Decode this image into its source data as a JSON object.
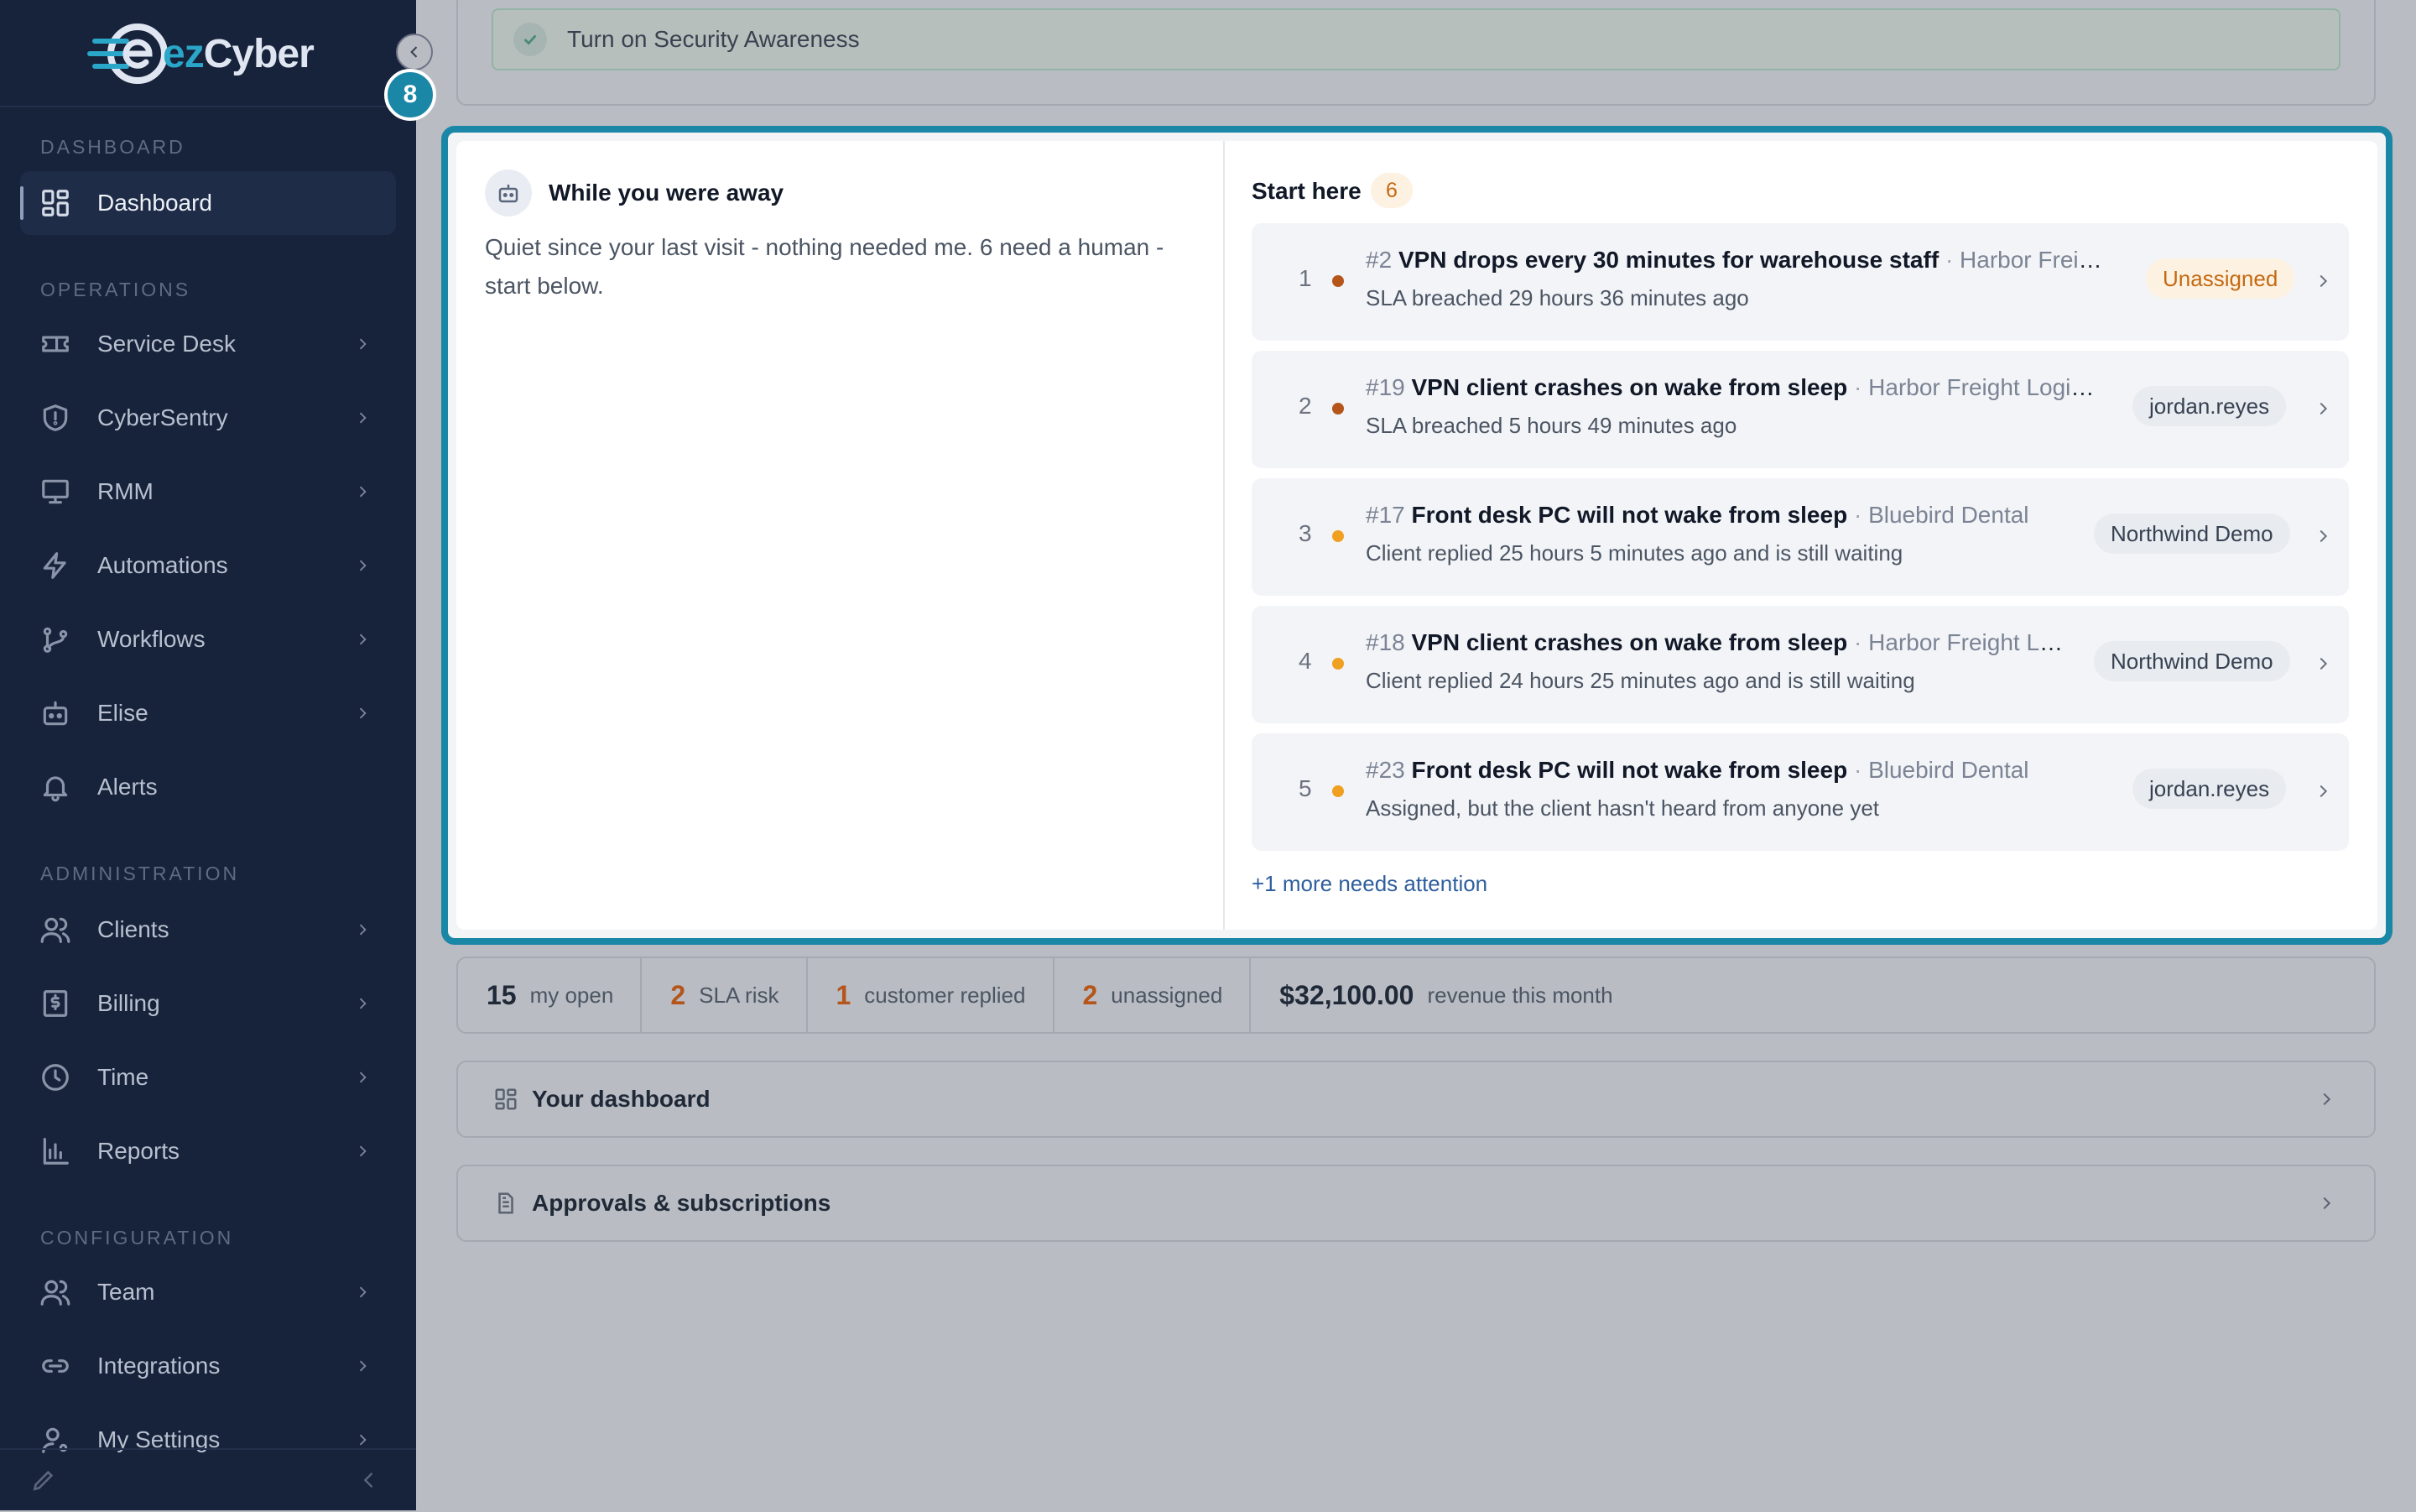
{
  "brand": {
    "name_prefix": "ez",
    "name_suffix": "Cyber"
  },
  "colors": {
    "accent": "#1b87a6",
    "sidebar_bg": "#17223b",
    "warning": "#c46a12",
    "breach_dot": "#b5551a",
    "waiting_dot": "#f0a020"
  },
  "step_badge": "8",
  "sidebar": {
    "sections": [
      {
        "label": "DASHBOARD",
        "items": [
          {
            "label": "Dashboard",
            "icon": "dashboard-grid-icon",
            "active": true
          }
        ]
      },
      {
        "label": "OPERATIONS",
        "items": [
          {
            "label": "Service Desk",
            "icon": "ticket-icon"
          },
          {
            "label": "CyberSentry",
            "icon": "shield-icon"
          },
          {
            "label": "RMM",
            "icon": "monitor-icon"
          },
          {
            "label": "Automations",
            "icon": "lightning-icon"
          },
          {
            "label": "Workflows",
            "icon": "git-branch-icon"
          },
          {
            "label": "Elise",
            "icon": "robot-icon"
          },
          {
            "label": "Alerts",
            "icon": "bell-icon"
          }
        ]
      },
      {
        "label": "ADMINISTRATION",
        "items": [
          {
            "label": "Clients",
            "icon": "users-icon"
          },
          {
            "label": "Billing",
            "icon": "dollar-receipt-icon"
          },
          {
            "label": "Time",
            "icon": "clock-icon"
          },
          {
            "label": "Reports",
            "icon": "bar-chart-icon"
          }
        ]
      },
      {
        "label": "CONFIGURATION",
        "items": [
          {
            "label": "Team",
            "icon": "team-icon"
          },
          {
            "label": "Integrations",
            "icon": "link-icon"
          },
          {
            "label": "My Settings",
            "icon": "user-settings-icon"
          }
        ]
      }
    ]
  },
  "banner": {
    "text": "Turn on Security Awareness"
  },
  "away": {
    "title": "While you were away",
    "text": "Quiet since your last visit - nothing needed me. 6 need a human - start below."
  },
  "start": {
    "title": "Start here",
    "count": "6",
    "tickets": [
      {
        "rank": "1",
        "id": "#2",
        "title": "VPN drops every 30 minutes for warehouse staff",
        "client": "Harbor Freight...",
        "status": "SLA breached 29 hours 36 minutes ago",
        "tag": "Unassigned",
        "tag_type": "unassigned",
        "dot": "breach"
      },
      {
        "rank": "2",
        "id": "#19",
        "title": "VPN client crashes on wake from sleep",
        "client": "Harbor Freight Logistics",
        "status": "SLA breached 5 hours 49 minutes ago",
        "tag": "jordan.reyes",
        "tag_type": "user",
        "dot": "breach"
      },
      {
        "rank": "3",
        "id": "#17",
        "title": "Front desk PC will not wake from sleep",
        "client": "Bluebird Dental",
        "status": "Client replied 25 hours 5 minutes ago and is still waiting",
        "tag": "Northwind Demo",
        "tag_type": "user",
        "dot": "waiting"
      },
      {
        "rank": "4",
        "id": "#18",
        "title": "VPN client crashes on wake from sleep",
        "client": "Harbor Freight Lo...",
        "status": "Client replied 24 hours 25 minutes ago and is still waiting",
        "tag": "Northwind Demo",
        "tag_type": "user",
        "dot": "waiting"
      },
      {
        "rank": "5",
        "id": "#23",
        "title": "Front desk PC will not wake from sleep",
        "client": "Bluebird Dental",
        "status": "Assigned, but the client hasn't heard from anyone yet",
        "tag": "jordan.reyes",
        "tag_type": "user",
        "dot": "waiting"
      }
    ],
    "more_link": "+1 more needs attention"
  },
  "stats": [
    {
      "value": "15",
      "label": "my open",
      "tone": "default"
    },
    {
      "value": "2",
      "label": "SLA risk",
      "tone": "orange"
    },
    {
      "value": "1",
      "label": "customer replied",
      "tone": "orange"
    },
    {
      "value": "2",
      "label": "unassigned",
      "tone": "orange"
    },
    {
      "value": "$32,100.00",
      "label": "revenue this month",
      "tone": "default"
    }
  ],
  "cards": [
    {
      "title": "Your dashboard",
      "icon": "dashboard-grid-icon"
    },
    {
      "title": "Approvals & subscriptions",
      "icon": "document-icon"
    }
  ]
}
